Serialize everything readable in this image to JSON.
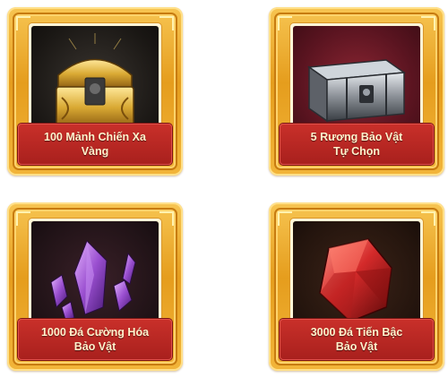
{
  "rewards": [
    {
      "label": "100 Mảnh Chiến Xa\nVàng",
      "icon": "gold-chest-icon",
      "art_color": "#d9a933"
    },
    {
      "label": "5 Rương Bảo Vật\nTự Chọn",
      "icon": "silver-chest-icon",
      "art_color": "#8a8f96"
    },
    {
      "label": "1000 Đá Cường Hóa\nBảo Vật",
      "icon": "purple-crystal-icon",
      "art_color": "#9a4fd0"
    },
    {
      "label": "3000 Đá Tiến Bậc\nBảo Vật",
      "icon": "red-gem-icon",
      "art_color": "#d42a2a"
    }
  ],
  "theme": {
    "card_gold": "#f2b53a",
    "banner_red": "#b5251f",
    "label_text": "#fff2cc"
  }
}
